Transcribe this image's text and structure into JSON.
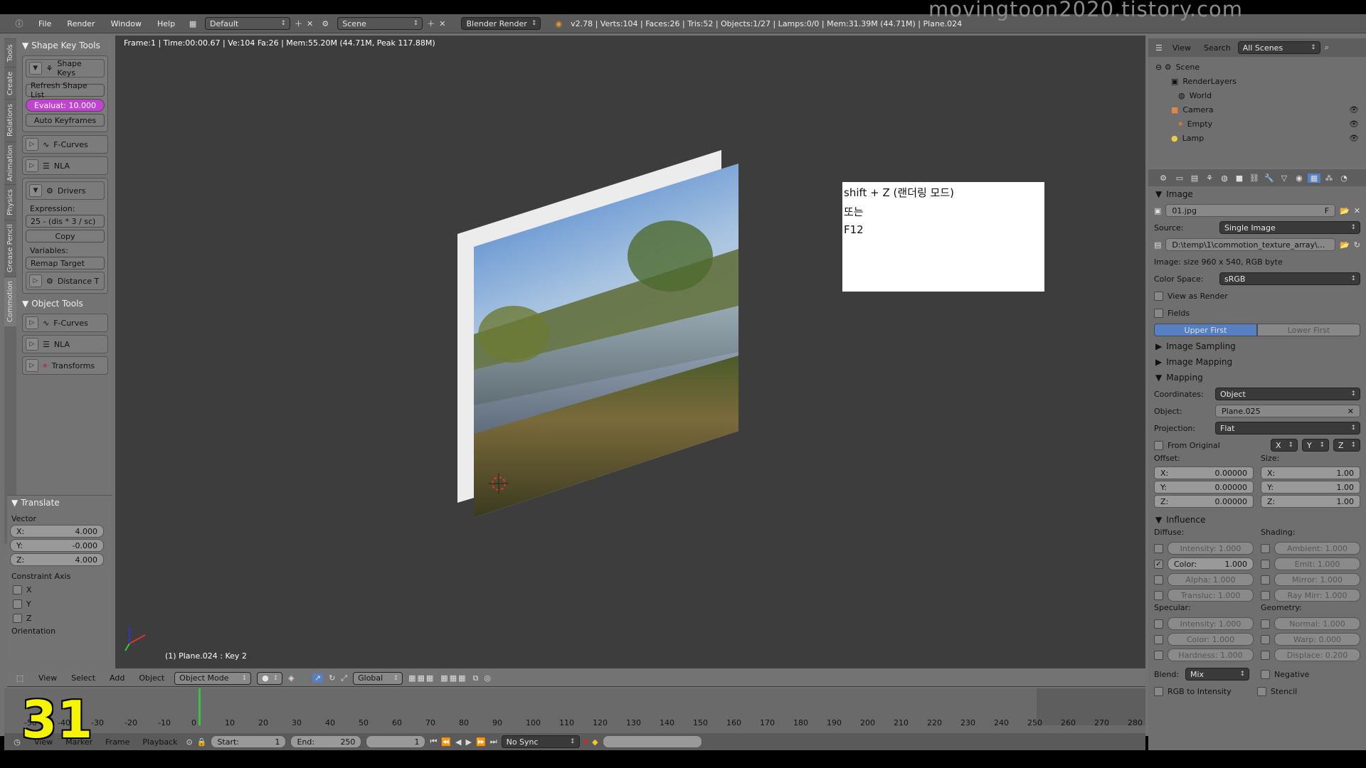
{
  "watermark": "movingtoon2020.tistory.com",
  "overlay_number": "31",
  "topbar": {
    "menus": [
      "File",
      "Render",
      "Window",
      "Help"
    ],
    "layout": "Default",
    "scene": "Scene",
    "engine": "Blender Render",
    "stats": "v2.78 | Verts:104 | Faces:26 | Tris:52 | Objects:1/27 | Lamps:0/0 | Mem:31.39M (44.71M) | Plane.024"
  },
  "tabs": [
    "Tools",
    "Create",
    "Relations",
    "Animation",
    "Physics",
    "Grease Pencil",
    "Commotion"
  ],
  "left": {
    "shape_key_tools": "Shape Key Tools",
    "shape_keys": "Shape Keys",
    "refresh": "Refresh Shape List",
    "evaluate": "Evaluat: 10.000",
    "auto_keyframes": "Auto Keyframes",
    "fcurves": "F-Curves",
    "nla": "NLA",
    "drivers": "Drivers",
    "expression_label": "Expression:",
    "expression": "25 - (dis * 3 / sc)",
    "copy": "Copy",
    "variables_label": "Variables:",
    "remap": "Remap Target",
    "distance": "Distance T",
    "object_tools": "Object Tools",
    "obj_fcurves": "F-Curves",
    "obj_nla": "NLA",
    "transforms": "Transforms"
  },
  "translate": {
    "title": "Translate",
    "vector": "Vector",
    "x_label": "X:",
    "x": "4.000",
    "y_label": "Y:",
    "y": "-0.000",
    "z_label": "Z:",
    "z": "4.000",
    "constraint": "Constraint Axis",
    "cx": "X",
    "cy": "Y",
    "cz": "Z",
    "orientation": "Orientation"
  },
  "viewport": {
    "info": "Frame:1 | Time:00:00.67 | Ve:104 Fa:26 | Mem:55.20M (44.71M, Peak 117.88M)",
    "object_name": "(1) Plane.024 : Key 2",
    "note_line1": "shift + Z (랜더링 모드)",
    "note_line2": "또는",
    "note_line3": "F12"
  },
  "vp_header": {
    "menus": [
      "View",
      "Select",
      "Add",
      "Object"
    ],
    "mode": "Object Mode",
    "orientation": "Global"
  },
  "timeline": {
    "frames": [
      "-50",
      "-40",
      "-30",
      "-20",
      "-10",
      "0",
      "10",
      "20",
      "30",
      "40",
      "50",
      "60",
      "70",
      "80",
      "90",
      "100",
      "110",
      "120",
      "130",
      "140",
      "150",
      "160",
      "170",
      "180",
      "190",
      "200",
      "210",
      "220",
      "230",
      "240",
      "250",
      "260",
      "270",
      "280"
    ],
    "menus": [
      "View",
      "Marker",
      "Frame",
      "Playback"
    ],
    "start": "Start:",
    "start_val": "1",
    "end": "End:",
    "end_val": "250",
    "current": "1",
    "sync": "No Sync"
  },
  "outliner": {
    "menus": [
      "View",
      "Search"
    ],
    "filter": "All Scenes",
    "items": [
      "Scene",
      "RenderLayers",
      "World",
      "Camera",
      "Empty",
      "Lamp"
    ]
  },
  "props": {
    "image_section": "Image",
    "image_name": "01.jpg",
    "fake_user": "F",
    "source_label": "Source:",
    "source": "Single Image",
    "path": "D:\\temp\\1\\commotion_texture_array\\...",
    "image_info": "Image: size 960 x 540, RGB byte",
    "colorspace_label": "Color Space:",
    "colorspace": "sRGB",
    "view_as_render": "View as Render",
    "fields": "Fields",
    "upper_first": "Upper First",
    "lower_first": "Lower First",
    "image_sampling": "Image Sampling",
    "image_mapping": "Image Mapping",
    "mapping": "Mapping",
    "coordinates_label": "Coordinates:",
    "coordinates": "Object",
    "object_label": "Object:",
    "object": "Plane.025",
    "projection_label": "Projection:",
    "projection": "Flat",
    "from_original": "From Original",
    "axis_x": "X",
    "axis_y": "Y",
    "axis_z": "Z",
    "offset_label": "Offset:",
    "size_label": "Size:",
    "offset_x": "0.00000",
    "offset_y": "0.00000",
    "offset_z": "0.00000",
    "size_x": "1.00",
    "size_y": "1.00",
    "size_z": "1.00",
    "x_label": "X:",
    "y_label": "Y:",
    "z_label": "Z:",
    "influence": "Influence",
    "diffuse_label": "Diffuse:",
    "shading_label": "Shading:",
    "intensity": "Intensity: 1.000",
    "color": "Color:",
    "color_val": "1.000",
    "alpha": "Alpha: 1.000",
    "transluc": "Transluc: 1.000",
    "ambient": "Ambient: 1.000",
    "emit": "Emit: 1.000",
    "mirror": "Mirror: 1.000",
    "ray_mirr": "Ray Mirr: 1.000",
    "specular_label": "Specular:",
    "geometry_label": "Geometry:",
    "spec_intensity": "Intensity: 1.000",
    "spec_color": "Color: 1.000",
    "hardness": "Hardness: 1.000",
    "normal": "Normal: 1.000",
    "warp": "Warp: 0.000",
    "displace": "Displace: 0.200",
    "blend_label": "Blend:",
    "blend": "Mix",
    "negative": "Negative",
    "rgb_to_intensity": "RGB to Intensity",
    "stencil": "Stencil"
  },
  "colors": {
    "accent_purple": "#c044d0",
    "selected_blue": "#5680c2",
    "playhead_green": "#3ac33a"
  }
}
